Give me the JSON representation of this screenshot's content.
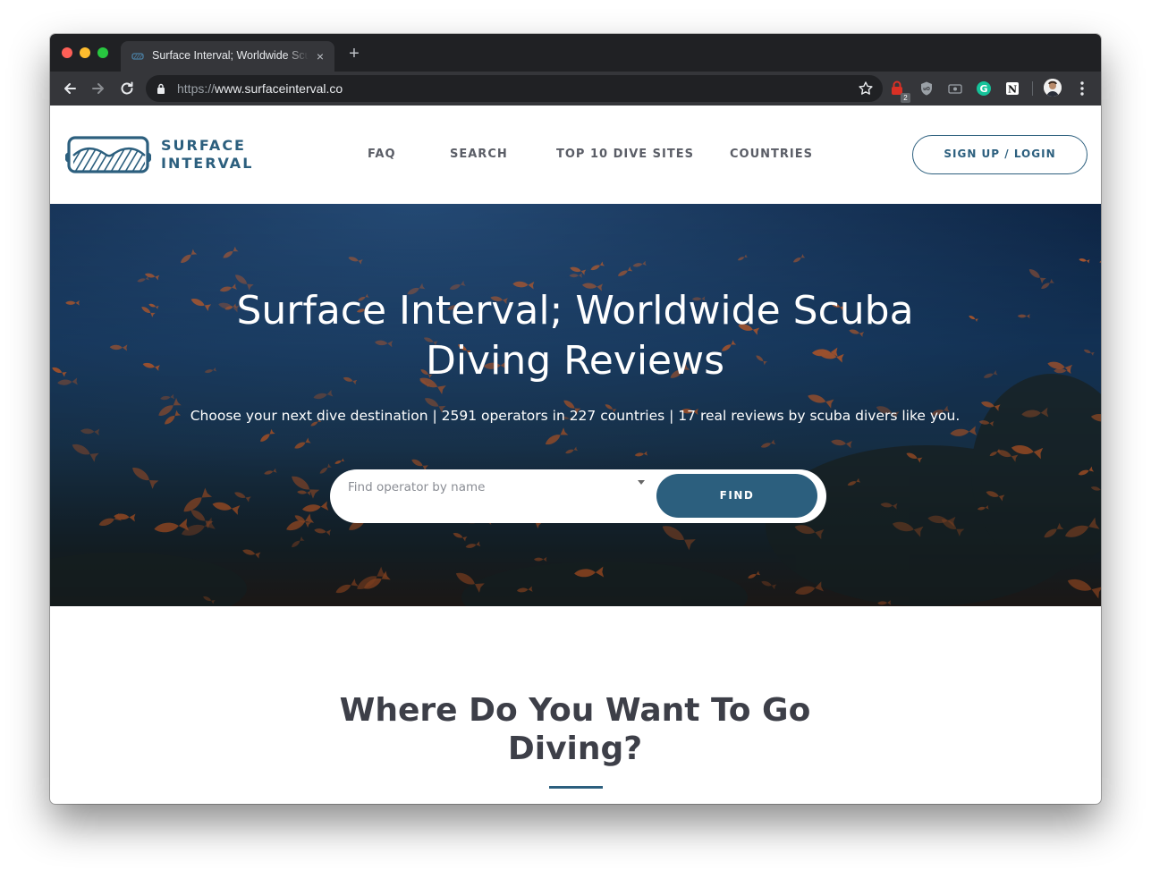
{
  "browser": {
    "tab_title": "Surface Interval; Worldwide Scuba Diving Reviews",
    "tab_close": "×",
    "new_tab": "+",
    "url_scheme": "https://",
    "url_host": "www.surfaceinterval.co",
    "extension_badge": "2"
  },
  "header": {
    "logo_line1": "SURFACE",
    "logo_line2": "INTERVAL",
    "nav": [
      {
        "label": "FAQ"
      },
      {
        "label": "SEARCH"
      },
      {
        "label": "TOP 10 DIVE SITES"
      },
      {
        "label": "COUNTRIES"
      }
    ],
    "signup_label": "SIGN UP / LOGIN"
  },
  "hero": {
    "title": "Surface Interval; Worldwide Scuba Diving Reviews",
    "subtitle": "Choose your next dive destination | 2591 operators in 227 countries | 17 real reviews by scuba divers like you.",
    "search_placeholder": "Find operator by name",
    "find_label": "FIND"
  },
  "section": {
    "title": "Where Do You Want To Go Diving?"
  },
  "colors": {
    "brand": "#2c5f7e",
    "heading": "#3d3f48",
    "nav_text": "#5a5d66"
  }
}
